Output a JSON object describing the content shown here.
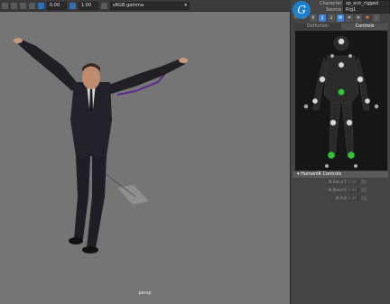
{
  "toolbar": {
    "exposure": "0.00",
    "gamma": "1.00",
    "color_space": "sRGB gamma"
  },
  "viewport": {
    "camera": "persp"
  },
  "hik": {
    "logo": "G",
    "character_label": "Character",
    "character_value": "sp_eric_rigged",
    "source_label": "Source",
    "source_value": "Rig1",
    "tabs": [
      "Definition",
      "Controls"
    ],
    "active_tab": "Controls",
    "section_title": "HumanIK Controls",
    "sliders": [
      {
        "label": "IK Blend T",
        "value": "0.00"
      },
      {
        "label": "IK Blend R",
        "value": "0.00"
      },
      {
        "label": "IK Pull",
        "value": "0.00"
      }
    ]
  },
  "colors": {
    "viewport_bg": "#757575",
    "panel_bg": "#444444",
    "accent_blue": "#2f6fb8",
    "ik_green": "#33c23a",
    "ik_white": "#d8d8d8"
  }
}
